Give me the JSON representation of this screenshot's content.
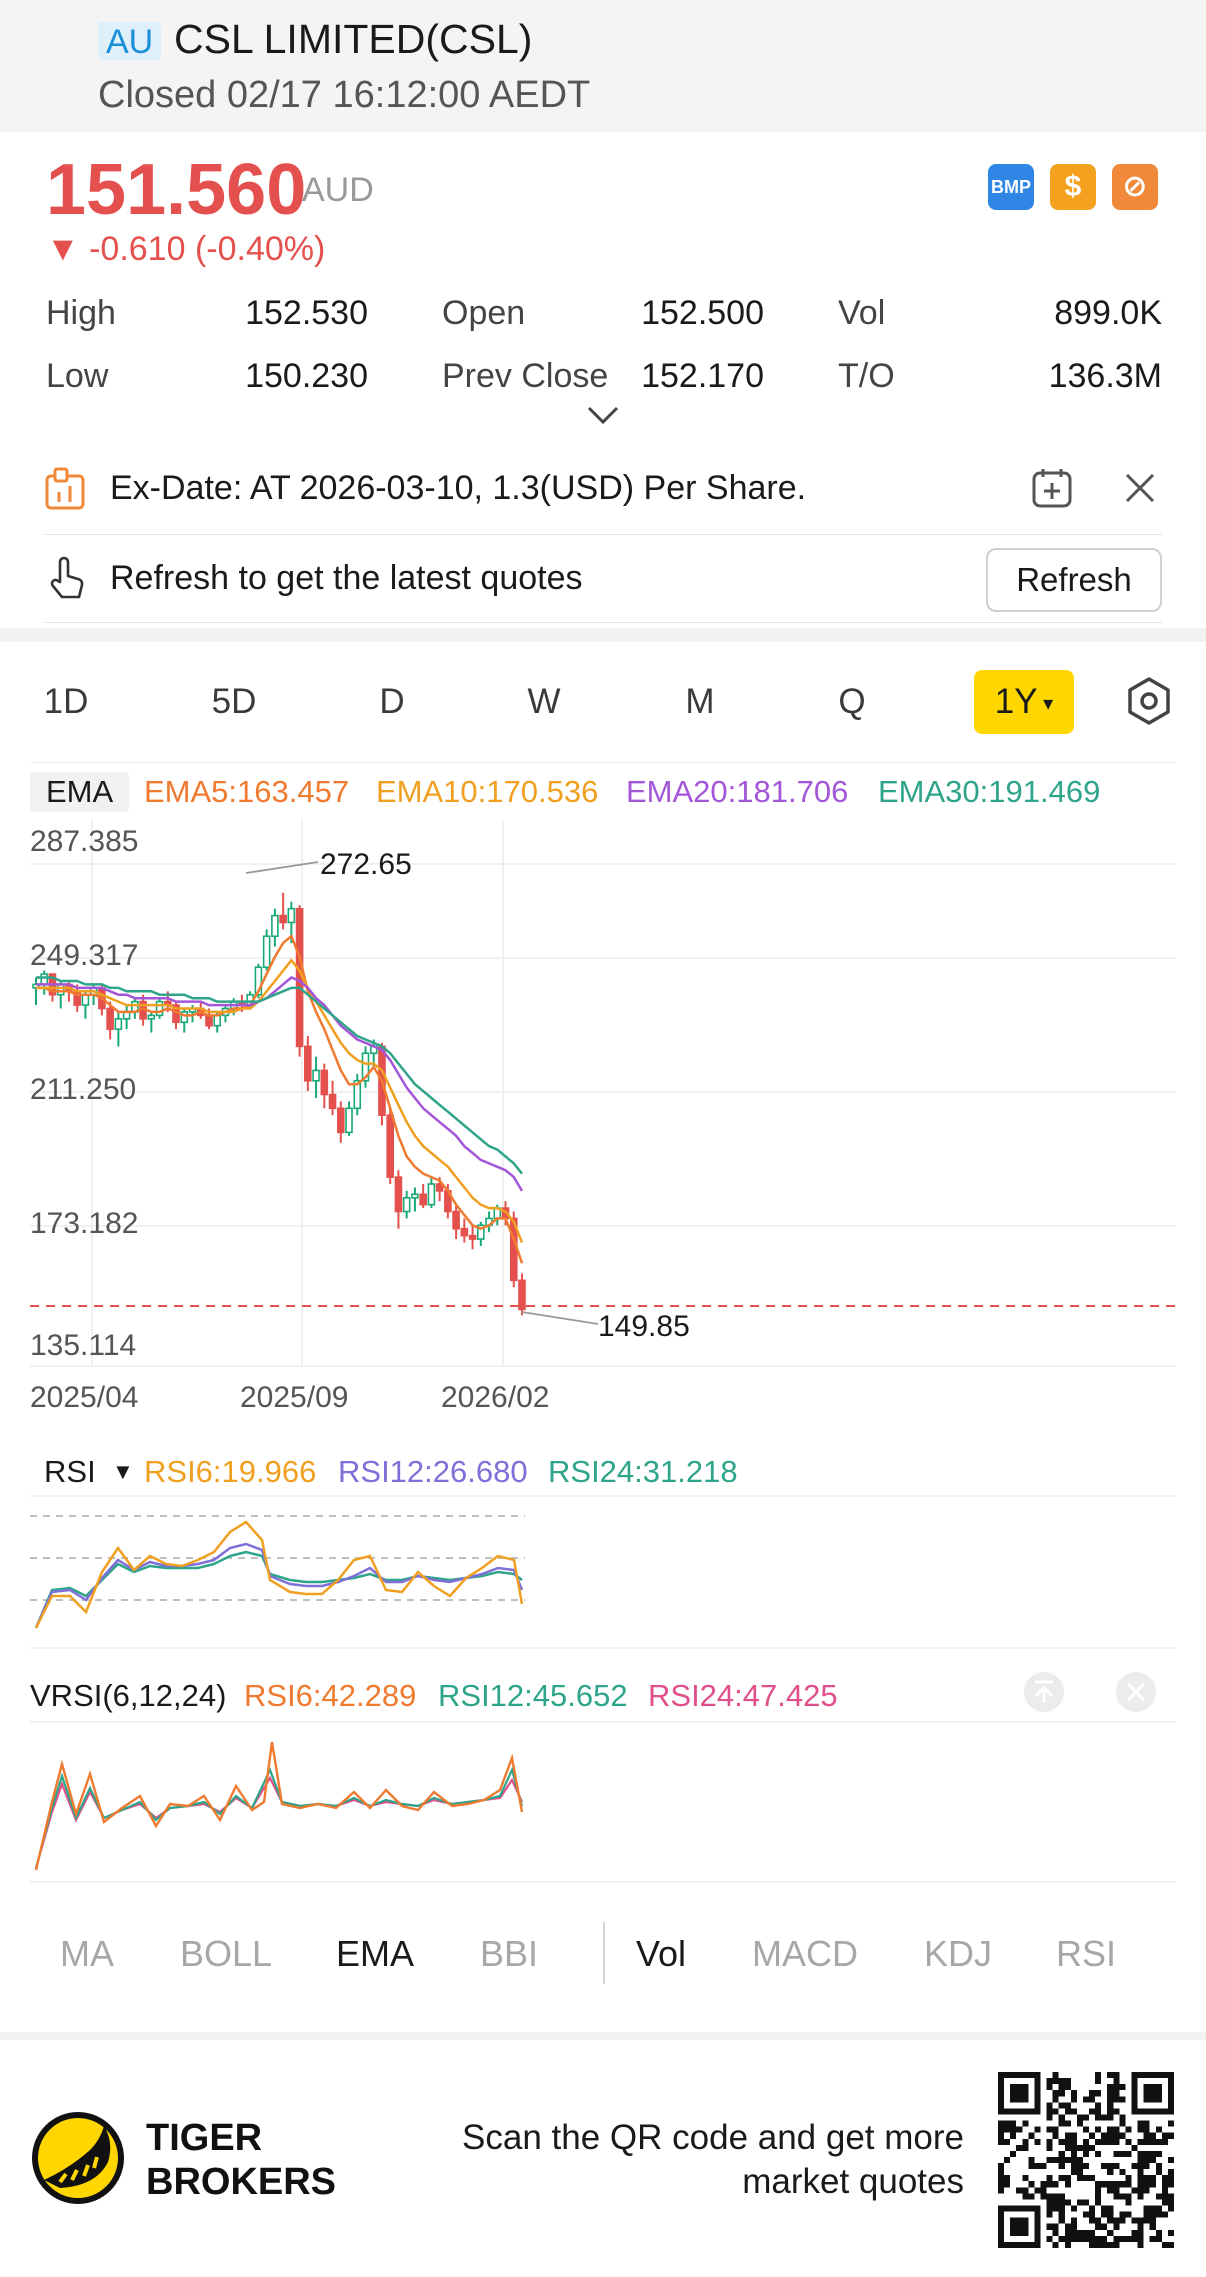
{
  "header": {
    "market_badge": "AU",
    "title": "CSL LIMITED(CSL)",
    "status": "Closed 02/17 16:12:00 AEDT"
  },
  "quote": {
    "price": "151.560",
    "currency": "AUD",
    "change": "▼ -0.610 (-0.40%)",
    "price_color": "#e4504d"
  },
  "badges": {
    "bmp": "BMP",
    "dollar": "$",
    "nosign": "⊘"
  },
  "stats": [
    {
      "label": "High",
      "value": "152.530"
    },
    {
      "label": "Open",
      "value": "152.500"
    },
    {
      "label": "Vol",
      "value": "899.0K"
    },
    {
      "label": "Low",
      "value": "150.230"
    },
    {
      "label": "Prev Close",
      "value": "152.170"
    },
    {
      "label": "T/O",
      "value": "136.3M"
    }
  ],
  "notices": {
    "ex_date": "Ex-Date: AT 2026-03-10, 1.3(USD) Per Share.",
    "refresh_hint": "Refresh to get the latest quotes",
    "refresh_button": "Refresh"
  },
  "period_tabs": [
    "1D",
    "5D",
    "D",
    "W",
    "M",
    "Q"
  ],
  "active_period": "1Y",
  "ema_legend": {
    "chip": "EMA",
    "ema5": "EMA5:163.457",
    "ema10": "EMA10:170.536",
    "ema20": "EMA20:181.706",
    "ema30": "EMA30:191.469"
  },
  "price_axis": [
    "287.385",
    "249.317",
    "211.250",
    "173.182",
    "135.114"
  ],
  "date_axis": [
    "2025/04",
    "2025/09",
    "2026/02"
  ],
  "chart_annotations": {
    "high": "272.65",
    "low": "149.85"
  },
  "rsi_legend": {
    "name": "RSI",
    "rsi6": "RSI6:19.966",
    "rsi12": "RSI12:26.680",
    "rsi24": "RSI24:31.218"
  },
  "vrsi_legend": {
    "name": "VRSI(6,12,24)",
    "rsi6": "RSI6:42.289",
    "rsi12": "RSI12:45.652",
    "rsi24": "RSI24:47.425"
  },
  "indicator_tabs_main": [
    "MA",
    "BOLL",
    "EMA",
    "BBI"
  ],
  "indicator_tabs_sub": [
    "Vol",
    "MACD",
    "KDJ",
    "RSI"
  ],
  "active_main_indicator": "EMA",
  "active_sub_indicator": "Vol",
  "footer": {
    "brand": "TIGER\nBROKERS",
    "scan_text": "Scan the QR code and get more\nmarket quotes"
  },
  "colors": {
    "up": "#19a974",
    "down": "#e4504d",
    "ema5": "#f07a2f",
    "ema10": "#f0a020",
    "ema20": "#a456d8",
    "ema30": "#2ea58a",
    "accent": "#ffd600"
  },
  "chart_data": {
    "type": "candlestick",
    "x_ticks": [
      "2025/04",
      "2025/09",
      "2026/02"
    ],
    "y_ticks": [
      287.385,
      249.317,
      211.25,
      173.182,
      135.114
    ],
    "ylim": [
      135.114,
      287.385
    ],
    "max_label": 272.65,
    "min_label": 149.85,
    "last_price": 151.56,
    "candles": [
      [
        245,
        248,
        240,
        246
      ],
      [
        246,
        250,
        243,
        249
      ],
      [
        249,
        249,
        241,
        243
      ],
      [
        243,
        247,
        239,
        246
      ],
      [
        246,
        247,
        241,
        244
      ],
      [
        244,
        246,
        238,
        240
      ],
      [
        240,
        244,
        236,
        243
      ],
      [
        243,
        246,
        240,
        245
      ],
      [
        245,
        246,
        237,
        239
      ],
      [
        239,
        241,
        230,
        233
      ],
      [
        233,
        238,
        228,
        236
      ],
      [
        236,
        240,
        233,
        238
      ],
      [
        238,
        242,
        236,
        241
      ],
      [
        241,
        243,
        234,
        236
      ],
      [
        236,
        238,
        232,
        237
      ],
      [
        237,
        242,
        236,
        241
      ],
      [
        241,
        244,
        238,
        240
      ],
      [
        240,
        241,
        233,
        235
      ],
      [
        235,
        239,
        232,
        238
      ],
      [
        238,
        240,
        235,
        239
      ],
      [
        239,
        241,
        236,
        237
      ],
      [
        237,
        239,
        233,
        234
      ],
      [
        234,
        238,
        232,
        237
      ],
      [
        237,
        240,
        235,
        239
      ],
      [
        239,
        242,
        237,
        241
      ],
      [
        241,
        243,
        238,
        240
      ],
      [
        240,
        244,
        239,
        243
      ],
      [
        243,
        252,
        242,
        251
      ],
      [
        251,
        262,
        250,
        260
      ],
      [
        260,
        268,
        257,
        266
      ],
      [
        266,
        272.65,
        262,
        264
      ],
      [
        264,
        270,
        258,
        268
      ],
      [
        268,
        269,
        225,
        228
      ],
      [
        228,
        231,
        215,
        218
      ],
      [
        218,
        225,
        213,
        221
      ],
      [
        221,
        223,
        210,
        214
      ],
      [
        214,
        218,
        208,
        210
      ],
      [
        210,
        212,
        200,
        203
      ],
      [
        203,
        212,
        202,
        210
      ],
      [
        210,
        220,
        208,
        218
      ],
      [
        218,
        228,
        216,
        226
      ],
      [
        226,
        230,
        222,
        228
      ],
      [
        228,
        229,
        205,
        208
      ],
      [
        208,
        210,
        188,
        190
      ],
      [
        190,
        192,
        175,
        180
      ],
      [
        180,
        186,
        178,
        184
      ],
      [
        184,
        187,
        180,
        185
      ],
      [
        185,
        188,
        181,
        182
      ],
      [
        182,
        190,
        181,
        188
      ],
      [
        188,
        190,
        183,
        186
      ],
      [
        186,
        188,
        178,
        180
      ],
      [
        180,
        182,
        172,
        175
      ],
      [
        175,
        178,
        171,
        173
      ],
      [
        173,
        176,
        169,
        172
      ],
      [
        172,
        177,
        170,
        176
      ],
      [
        176,
        180,
        174,
        178
      ],
      [
        178,
        182,
        176,
        181
      ],
      [
        181,
        183,
        176,
        178
      ],
      [
        178,
        180,
        158,
        160
      ],
      [
        160,
        162,
        149.85,
        151.56
      ]
    ],
    "ema_series": [
      {
        "name": "EMA5",
        "values": [
          245,
          245,
          244,
          244,
          244,
          243,
          243,
          243,
          242,
          240,
          238,
          238,
          238,
          239,
          238,
          238,
          239,
          238,
          237,
          237,
          238,
          237,
          237,
          238,
          239,
          239,
          240,
          244,
          249,
          254,
          258,
          260,
          254,
          244,
          238,
          233,
          227,
          221,
          217,
          217,
          219,
          222,
          218,
          210,
          202,
          196,
          193,
          191,
          190,
          189,
          186,
          182,
          179,
          176,
          175,
          176,
          178,
          178,
          172,
          165
        ]
      },
      {
        "name": "EMA10",
        "values": [
          245,
          245,
          245,
          245,
          245,
          244,
          244,
          244,
          243,
          242,
          241,
          240,
          240,
          240,
          240,
          240,
          240,
          239,
          239,
          239,
          239,
          238,
          238,
          238,
          238,
          239,
          239,
          241,
          244,
          247,
          250,
          253,
          250,
          245,
          241,
          237,
          233,
          229,
          226,
          224,
          223,
          223,
          221,
          216,
          211,
          206,
          202,
          199,
          197,
          195,
          193,
          190,
          187,
          184,
          182,
          181,
          181,
          180,
          177,
          171
        ]
      },
      {
        "name": "EMA20",
        "values": [
          246,
          246,
          246,
          246,
          246,
          245,
          245,
          245,
          245,
          244,
          243,
          243,
          242,
          242,
          242,
          242,
          242,
          241,
          241,
          241,
          241,
          240,
          240,
          240,
          240,
          240,
          240,
          241,
          242,
          244,
          246,
          248,
          247,
          245,
          242,
          240,
          237,
          234,
          232,
          230,
          229,
          228,
          227,
          224,
          220,
          216,
          213,
          210,
          208,
          206,
          204,
          202,
          199,
          197,
          195,
          194,
          193,
          192,
          190,
          186
        ]
      },
      {
        "name": "EMA30",
        "values": [
          248,
          248,
          248,
          247,
          247,
          247,
          246,
          246,
          246,
          245,
          245,
          244,
          244,
          244,
          244,
          243,
          243,
          243,
          243,
          242,
          242,
          242,
          241,
          241,
          241,
          241,
          241,
          241,
          242,
          243,
          244,
          245,
          245,
          243,
          241,
          239,
          237,
          235,
          233,
          231,
          230,
          229,
          228,
          226,
          223,
          220,
          217,
          215,
          213,
          211,
          209,
          207,
          205,
          203,
          201,
          199,
          198,
          196,
          194,
          191
        ]
      }
    ]
  }
}
